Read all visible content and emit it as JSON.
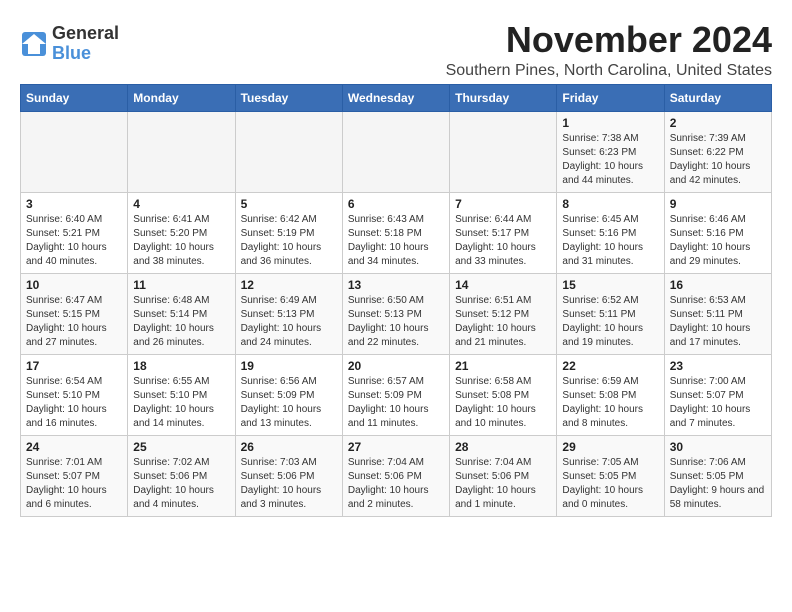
{
  "logo": {
    "general": "General",
    "blue": "Blue"
  },
  "title": "November 2024",
  "location": "Southern Pines, North Carolina, United States",
  "weekdays": [
    "Sunday",
    "Monday",
    "Tuesday",
    "Wednesday",
    "Thursday",
    "Friday",
    "Saturday"
  ],
  "weeks": [
    [
      {
        "day": "",
        "info": ""
      },
      {
        "day": "",
        "info": ""
      },
      {
        "day": "",
        "info": ""
      },
      {
        "day": "",
        "info": ""
      },
      {
        "day": "",
        "info": ""
      },
      {
        "day": "1",
        "info": "Sunrise: 7:38 AM\nSunset: 6:23 PM\nDaylight: 10 hours and 44 minutes."
      },
      {
        "day": "2",
        "info": "Sunrise: 7:39 AM\nSunset: 6:22 PM\nDaylight: 10 hours and 42 minutes."
      }
    ],
    [
      {
        "day": "3",
        "info": "Sunrise: 6:40 AM\nSunset: 5:21 PM\nDaylight: 10 hours and 40 minutes."
      },
      {
        "day": "4",
        "info": "Sunrise: 6:41 AM\nSunset: 5:20 PM\nDaylight: 10 hours and 38 minutes."
      },
      {
        "day": "5",
        "info": "Sunrise: 6:42 AM\nSunset: 5:19 PM\nDaylight: 10 hours and 36 minutes."
      },
      {
        "day": "6",
        "info": "Sunrise: 6:43 AM\nSunset: 5:18 PM\nDaylight: 10 hours and 34 minutes."
      },
      {
        "day": "7",
        "info": "Sunrise: 6:44 AM\nSunset: 5:17 PM\nDaylight: 10 hours and 33 minutes."
      },
      {
        "day": "8",
        "info": "Sunrise: 6:45 AM\nSunset: 5:16 PM\nDaylight: 10 hours and 31 minutes."
      },
      {
        "day": "9",
        "info": "Sunrise: 6:46 AM\nSunset: 5:16 PM\nDaylight: 10 hours and 29 minutes."
      }
    ],
    [
      {
        "day": "10",
        "info": "Sunrise: 6:47 AM\nSunset: 5:15 PM\nDaylight: 10 hours and 27 minutes."
      },
      {
        "day": "11",
        "info": "Sunrise: 6:48 AM\nSunset: 5:14 PM\nDaylight: 10 hours and 26 minutes."
      },
      {
        "day": "12",
        "info": "Sunrise: 6:49 AM\nSunset: 5:13 PM\nDaylight: 10 hours and 24 minutes."
      },
      {
        "day": "13",
        "info": "Sunrise: 6:50 AM\nSunset: 5:13 PM\nDaylight: 10 hours and 22 minutes."
      },
      {
        "day": "14",
        "info": "Sunrise: 6:51 AM\nSunset: 5:12 PM\nDaylight: 10 hours and 21 minutes."
      },
      {
        "day": "15",
        "info": "Sunrise: 6:52 AM\nSunset: 5:11 PM\nDaylight: 10 hours and 19 minutes."
      },
      {
        "day": "16",
        "info": "Sunrise: 6:53 AM\nSunset: 5:11 PM\nDaylight: 10 hours and 17 minutes."
      }
    ],
    [
      {
        "day": "17",
        "info": "Sunrise: 6:54 AM\nSunset: 5:10 PM\nDaylight: 10 hours and 16 minutes."
      },
      {
        "day": "18",
        "info": "Sunrise: 6:55 AM\nSunset: 5:10 PM\nDaylight: 10 hours and 14 minutes."
      },
      {
        "day": "19",
        "info": "Sunrise: 6:56 AM\nSunset: 5:09 PM\nDaylight: 10 hours and 13 minutes."
      },
      {
        "day": "20",
        "info": "Sunrise: 6:57 AM\nSunset: 5:09 PM\nDaylight: 10 hours and 11 minutes."
      },
      {
        "day": "21",
        "info": "Sunrise: 6:58 AM\nSunset: 5:08 PM\nDaylight: 10 hours and 10 minutes."
      },
      {
        "day": "22",
        "info": "Sunrise: 6:59 AM\nSunset: 5:08 PM\nDaylight: 10 hours and 8 minutes."
      },
      {
        "day": "23",
        "info": "Sunrise: 7:00 AM\nSunset: 5:07 PM\nDaylight: 10 hours and 7 minutes."
      }
    ],
    [
      {
        "day": "24",
        "info": "Sunrise: 7:01 AM\nSunset: 5:07 PM\nDaylight: 10 hours and 6 minutes."
      },
      {
        "day": "25",
        "info": "Sunrise: 7:02 AM\nSunset: 5:06 PM\nDaylight: 10 hours and 4 minutes."
      },
      {
        "day": "26",
        "info": "Sunrise: 7:03 AM\nSunset: 5:06 PM\nDaylight: 10 hours and 3 minutes."
      },
      {
        "day": "27",
        "info": "Sunrise: 7:04 AM\nSunset: 5:06 PM\nDaylight: 10 hours and 2 minutes."
      },
      {
        "day": "28",
        "info": "Sunrise: 7:04 AM\nSunset: 5:06 PM\nDaylight: 10 hours and 1 minute."
      },
      {
        "day": "29",
        "info": "Sunrise: 7:05 AM\nSunset: 5:05 PM\nDaylight: 10 hours and 0 minutes."
      },
      {
        "day": "30",
        "info": "Sunrise: 7:06 AM\nSunset: 5:05 PM\nDaylight: 9 hours and 58 minutes."
      }
    ]
  ]
}
